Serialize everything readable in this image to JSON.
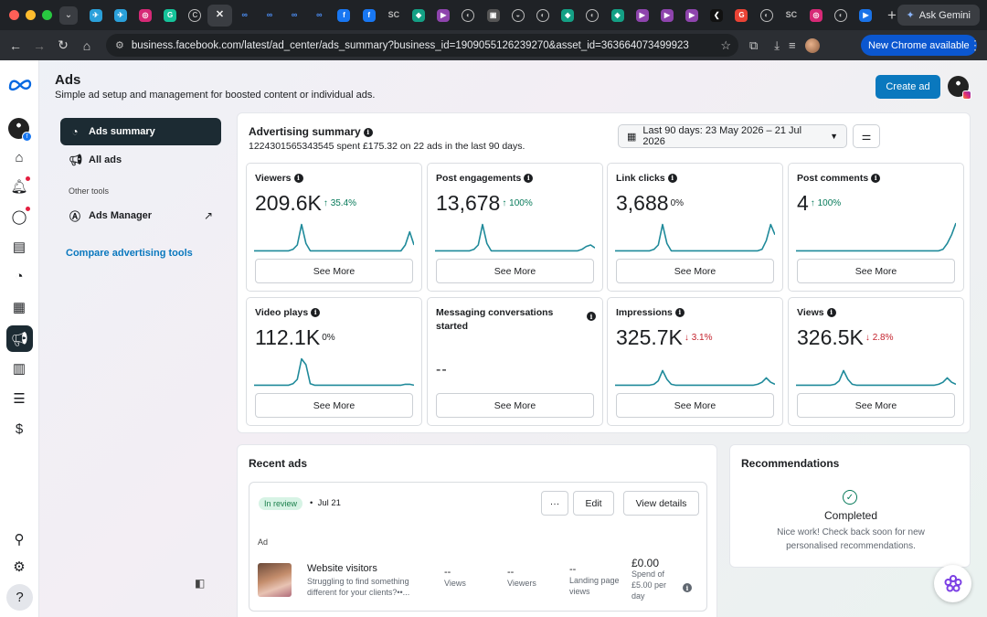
{
  "browser": {
    "tabs": [
      {
        "name": "telegram",
        "color": "#2aa0da",
        "glyph": "✈"
      },
      {
        "name": "telegram",
        "color": "#2aa0da",
        "glyph": "✈"
      },
      {
        "name": "instagram",
        "color": "#d62976",
        "glyph": "◎"
      },
      {
        "name": "grammarly",
        "color": "#15c39a",
        "glyph": "G"
      },
      {
        "name": "ring",
        "color": "",
        "glyph": "C"
      },
      {
        "name": "close",
        "color": "",
        "glyph": "✕"
      },
      {
        "name": "meta",
        "color": "",
        "glyph": "∞"
      },
      {
        "name": "meta",
        "color": "",
        "glyph": "∞"
      },
      {
        "name": "meta",
        "color": "",
        "glyph": "∞"
      },
      {
        "name": "meta",
        "color": "",
        "glyph": "∞"
      },
      {
        "name": "facebook",
        "color": "#1877f2",
        "glyph": "f"
      },
      {
        "name": "facebook",
        "color": "#1877f2",
        "glyph": "f"
      },
      {
        "name": "text",
        "color": "",
        "glyph": "SC"
      },
      {
        "name": "app",
        "color": "#14a085",
        "glyph": "◆"
      },
      {
        "name": "app",
        "color": "#8e44ad",
        "glyph": "▶"
      },
      {
        "name": "ring",
        "color": "",
        "glyph": "◐"
      },
      {
        "name": "app",
        "color": "#555",
        "glyph": "▣"
      },
      {
        "name": "ring",
        "color": "",
        "glyph": "◒"
      },
      {
        "name": "ring",
        "color": "",
        "glyph": "◐"
      },
      {
        "name": "app",
        "color": "#14a085",
        "glyph": "◆"
      },
      {
        "name": "ring",
        "color": "",
        "glyph": "◐"
      },
      {
        "name": "app",
        "color": "#14a085",
        "glyph": "◆"
      },
      {
        "name": "app",
        "color": "#8e44ad",
        "glyph": "▶"
      },
      {
        "name": "app",
        "color": "#8e44ad",
        "glyph": "▶"
      },
      {
        "name": "app",
        "color": "#8e44ad",
        "glyph": "▶"
      },
      {
        "name": "app",
        "color": "#111",
        "glyph": "❮"
      },
      {
        "name": "google",
        "color": "#ea4335",
        "glyph": "G"
      },
      {
        "name": "ring",
        "color": "",
        "glyph": "◐"
      },
      {
        "name": "text",
        "color": "",
        "glyph": "SC"
      },
      {
        "name": "instagram",
        "color": "#d62976",
        "glyph": "◎"
      },
      {
        "name": "ring",
        "color": "",
        "glyph": "◐"
      },
      {
        "name": "app",
        "color": "#1a73e8",
        "glyph": "▶"
      }
    ],
    "ask_gemini": "Ask Gemini",
    "url": "business.facebook.com/latest/ad_center/ads_summary?business_id=1909055126239270&asset_id=363664073499923",
    "new_chrome": "New Chrome available"
  },
  "header": {
    "title": "Ads",
    "subtitle": "Simple ad setup and management for boosted content or individual ads.",
    "create_ad": "Create ad"
  },
  "left_nav": {
    "items": [
      {
        "label": "Ads summary",
        "icon": "gauge-icon",
        "glyph": "◔"
      },
      {
        "label": "All ads",
        "icon": "megaphone-icon",
        "glyph": "📢"
      }
    ],
    "other_tools_heading": "Other tools",
    "ads_manager": "Ads Manager",
    "compare_link": "Compare advertising tools"
  },
  "summary": {
    "title": "Advertising summary",
    "description": "1224301565343545 spent £175.32 on 22 ads in the last 90 days.",
    "date_range": "Last 90 days: 23 May 2026 – 21 Jul 2026",
    "see_more": "See More",
    "metrics": [
      {
        "label": "Viewers",
        "value": "209.6K",
        "arrow": "↑",
        "change": "35.4%",
        "trend": "up",
        "spark": [
          0.05,
          0.05,
          0.05,
          0.05,
          0.05,
          0.05,
          0.05,
          0.05,
          0.05,
          0.1,
          0.25,
          0.95,
          0.3,
          0.05,
          0.05,
          0.05,
          0.05,
          0.05,
          0.05,
          0.05,
          0.05,
          0.05,
          0.05,
          0.05,
          0.05,
          0.05,
          0.05,
          0.05,
          0.05,
          0.05,
          0.05,
          0.05,
          0.05,
          0.05,
          0.05,
          0.25,
          0.7,
          0.25
        ]
      },
      {
        "label": "Post engagements",
        "value": "13,678",
        "arrow": "↑",
        "change": "100%",
        "trend": "up",
        "spark": [
          0.05,
          0.05,
          0.05,
          0.05,
          0.05,
          0.05,
          0.05,
          0.05,
          0.05,
          0.1,
          0.25,
          0.95,
          0.3,
          0.05,
          0.05,
          0.05,
          0.05,
          0.05,
          0.05,
          0.05,
          0.05,
          0.05,
          0.05,
          0.05,
          0.05,
          0.05,
          0.05,
          0.05,
          0.05,
          0.05,
          0.05,
          0.05,
          0.05,
          0.05,
          0.1,
          0.2,
          0.25,
          0.15
        ]
      },
      {
        "label": "Link clicks",
        "value": "3,688",
        "arrow": "",
        "change": "0%",
        "trend": "flat",
        "spark": [
          0.05,
          0.05,
          0.05,
          0.05,
          0.05,
          0.05,
          0.05,
          0.05,
          0.05,
          0.1,
          0.25,
          0.95,
          0.3,
          0.05,
          0.05,
          0.05,
          0.05,
          0.05,
          0.05,
          0.05,
          0.05,
          0.05,
          0.05,
          0.05,
          0.05,
          0.05,
          0.05,
          0.05,
          0.05,
          0.05,
          0.05,
          0.05,
          0.05,
          0.05,
          0.1,
          0.4,
          0.95,
          0.6
        ]
      },
      {
        "label": "Post comments",
        "value": "4",
        "arrow": "↑",
        "change": "100%",
        "trend": "up",
        "spark": [
          0.05,
          0.05,
          0.05,
          0.05,
          0.05,
          0.05,
          0.05,
          0.05,
          0.05,
          0.05,
          0.05,
          0.05,
          0.05,
          0.05,
          0.05,
          0.05,
          0.05,
          0.05,
          0.05,
          0.05,
          0.05,
          0.05,
          0.05,
          0.05,
          0.05,
          0.05,
          0.05,
          0.05,
          0.05,
          0.05,
          0.05,
          0.05,
          0.05,
          0.05,
          0.1,
          0.3,
          0.6,
          1.0
        ]
      },
      {
        "label": "Video plays",
        "value": "112.1K",
        "arrow": "",
        "change": "0%",
        "trend": "flat",
        "spark": [
          0.05,
          0.05,
          0.05,
          0.05,
          0.05,
          0.05,
          0.05,
          0.05,
          0.05,
          0.1,
          0.25,
          0.95,
          0.75,
          0.1,
          0.05,
          0.05,
          0.05,
          0.05,
          0.05,
          0.05,
          0.05,
          0.05,
          0.05,
          0.05,
          0.05,
          0.05,
          0.05,
          0.05,
          0.05,
          0.05,
          0.05,
          0.05,
          0.05,
          0.05,
          0.05,
          0.08,
          0.08,
          0.05
        ]
      },
      {
        "label": "Messaging conversations started",
        "value": "--",
        "arrow": "",
        "change": "",
        "trend": "none",
        "spark": []
      },
      {
        "label": "Impressions",
        "value": "325.7K",
        "arrow": "↓",
        "change": "3.1%",
        "trend": "down",
        "spark": [
          0.05,
          0.05,
          0.05,
          0.05,
          0.05,
          0.05,
          0.05,
          0.05,
          0.05,
          0.08,
          0.2,
          0.55,
          0.25,
          0.08,
          0.05,
          0.05,
          0.05,
          0.05,
          0.05,
          0.05,
          0.05,
          0.05,
          0.05,
          0.05,
          0.05,
          0.05,
          0.05,
          0.05,
          0.05,
          0.05,
          0.05,
          0.05,
          0.05,
          0.08,
          0.15,
          0.3,
          0.15,
          0.08
        ]
      },
      {
        "label": "Views",
        "value": "326.5K",
        "arrow": "↓",
        "change": "2.8%",
        "trend": "down",
        "spark": [
          0.05,
          0.05,
          0.05,
          0.05,
          0.05,
          0.05,
          0.05,
          0.05,
          0.05,
          0.08,
          0.2,
          0.55,
          0.25,
          0.08,
          0.05,
          0.05,
          0.05,
          0.05,
          0.05,
          0.05,
          0.05,
          0.05,
          0.05,
          0.05,
          0.05,
          0.05,
          0.05,
          0.05,
          0.05,
          0.05,
          0.05,
          0.05,
          0.05,
          0.08,
          0.15,
          0.3,
          0.15,
          0.08
        ]
      }
    ]
  },
  "recent_ads": {
    "title": "Recent ads",
    "status": "In review",
    "date": "Jul 21",
    "more_label": "···",
    "edit": "Edit",
    "view_details": "View details",
    "ad_label": "Ad",
    "ad_name": "Website visitors",
    "ad_text": "Struggling to find something different for your clients?••...",
    "views_value": "--",
    "views_label": "Views",
    "viewers_value": "--",
    "viewers_label": "Viewers",
    "landing_value": "--",
    "landing_label": "Landing page views",
    "spend_value": "£0.00",
    "spend_label": "Spend of £5.00 per day"
  },
  "recommendations": {
    "title": "Recommendations",
    "status": "Completed",
    "text": "Nice work! Check back soon for new personalised recommendations."
  },
  "colors": {
    "accent": "#0a78be",
    "spark": "#1f8a9a",
    "up": "#077a5a",
    "down": "#c4222d"
  }
}
